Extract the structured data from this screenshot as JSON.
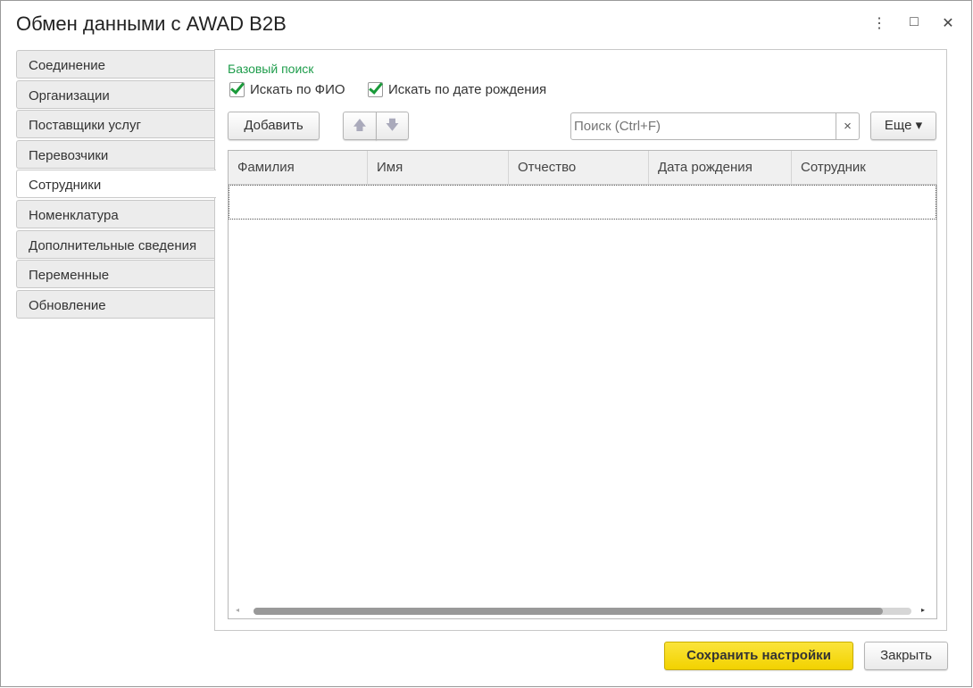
{
  "window": {
    "title": "Обмен данными с AWAD B2B",
    "menu_icon": "⋮",
    "maximize_icon": "□",
    "close_icon": "✕"
  },
  "tabs": [
    {
      "label": "Соединение"
    },
    {
      "label": "Организации"
    },
    {
      "label": "Поставщики услуг"
    },
    {
      "label": "Перевозчики"
    },
    {
      "label": "Сотрудники",
      "active": true
    },
    {
      "label": "Номенклатура"
    },
    {
      "label": "Дополнительные сведения"
    },
    {
      "label": "Переменные"
    },
    {
      "label": "Обновление"
    }
  ],
  "search_group": {
    "title": "Базовый поиск",
    "by_name": "Искать по ФИО",
    "by_birthdate": "Искать по дате рождения"
  },
  "toolbar": {
    "add": "Добавить",
    "up": "🡅",
    "down": "🡇",
    "search_placeholder": "Поиск (Ctrl+F)",
    "clear": "×",
    "more": "Еще ▾"
  },
  "table": {
    "columns": [
      "Фамилия",
      "Имя",
      "Отчество",
      "Дата рождения",
      "Сотрудник"
    ],
    "rows": []
  },
  "footer": {
    "save": "Сохранить настройки",
    "close": "Закрыть"
  },
  "colors": {
    "accent_green": "#1f9d4c",
    "save_yellow": "#f5d800"
  }
}
